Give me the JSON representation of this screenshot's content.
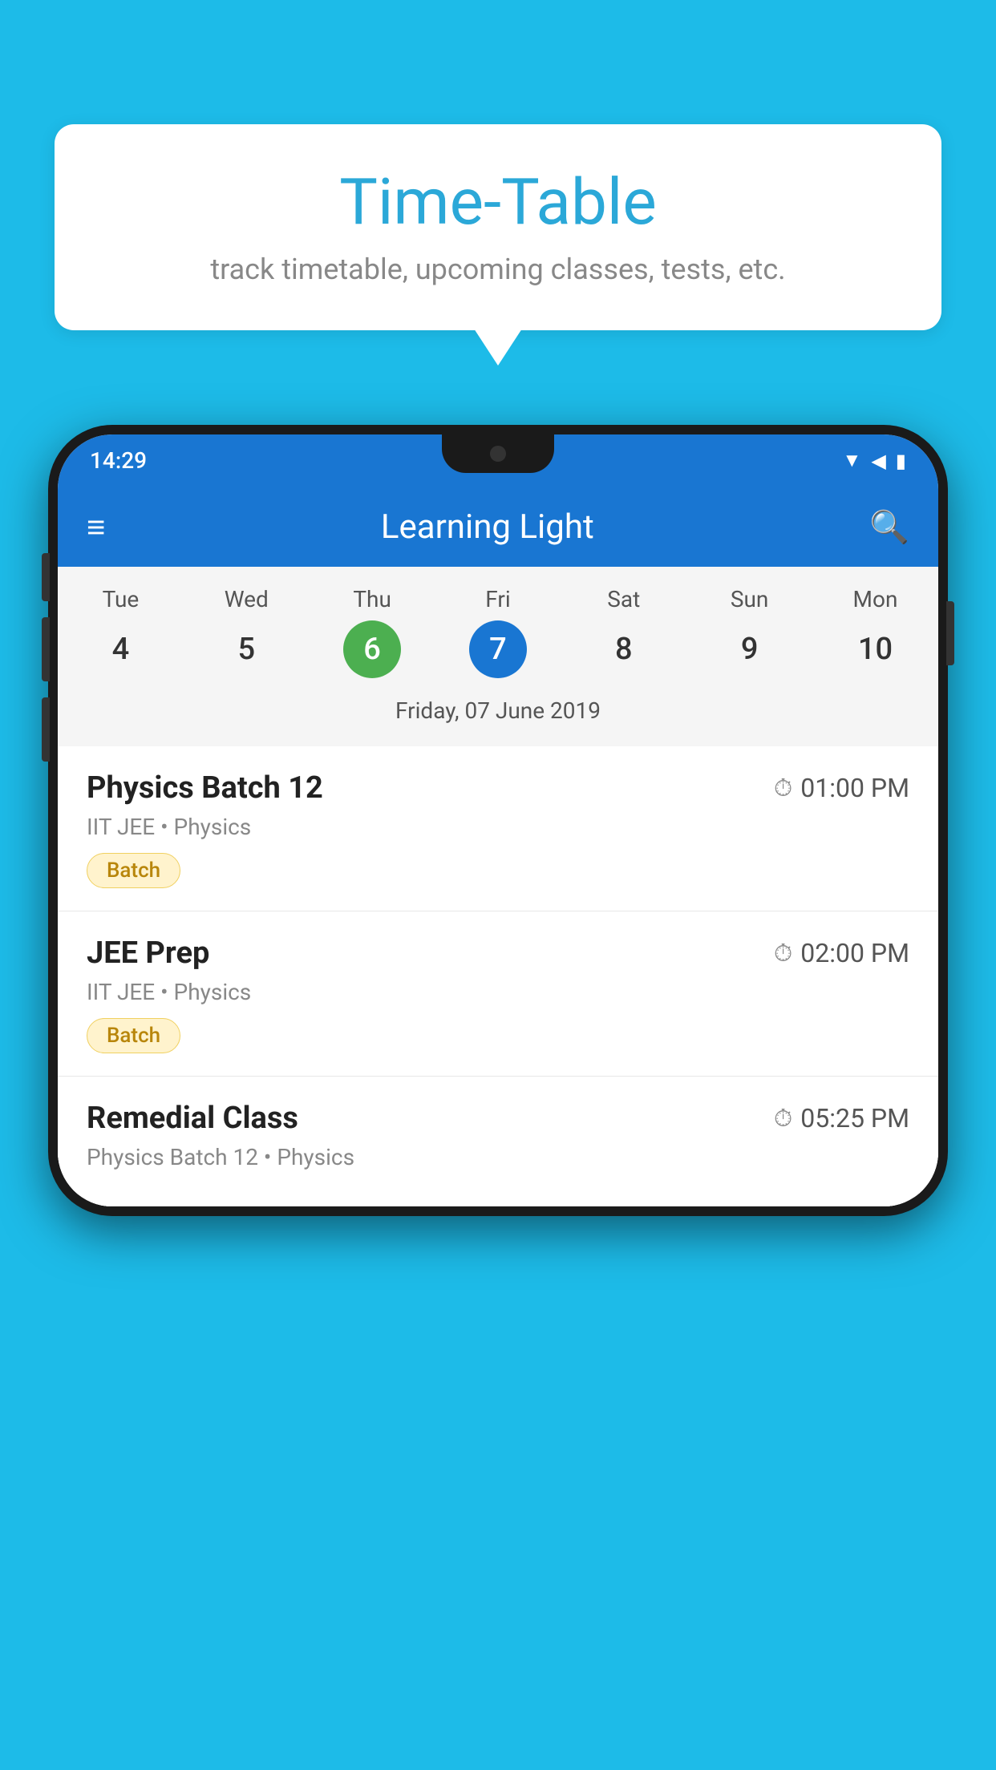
{
  "background": {
    "color": "#1DBBE8"
  },
  "bubble": {
    "title": "Time-Table",
    "subtitle": "track timetable, upcoming classes, tests, etc."
  },
  "phone": {
    "statusBar": {
      "time": "14:29"
    },
    "toolbar": {
      "title": "Learning Light",
      "menuIcon": "☰",
      "searchIcon": "🔍"
    },
    "calendar": {
      "days": [
        {
          "name": "Tue",
          "number": "4",
          "state": "normal"
        },
        {
          "name": "Wed",
          "number": "5",
          "state": "normal"
        },
        {
          "name": "Thu",
          "number": "6",
          "state": "today"
        },
        {
          "name": "Fri",
          "number": "7",
          "state": "selected"
        },
        {
          "name": "Sat",
          "number": "8",
          "state": "normal"
        },
        {
          "name": "Sun",
          "number": "9",
          "state": "normal"
        },
        {
          "name": "Mon",
          "number": "10",
          "state": "normal"
        }
      ],
      "selectedDateLabel": "Friday, 07 June 2019"
    },
    "schedule": [
      {
        "title": "Physics Batch 12",
        "time": "01:00 PM",
        "subtitle": "IIT JEE • Physics",
        "tag": "Batch"
      },
      {
        "title": "JEE Prep",
        "time": "02:00 PM",
        "subtitle": "IIT JEE • Physics",
        "tag": "Batch"
      },
      {
        "title": "Remedial Class",
        "time": "05:25 PM",
        "subtitle": "Physics Batch 12 • Physics",
        "tag": ""
      }
    ]
  }
}
